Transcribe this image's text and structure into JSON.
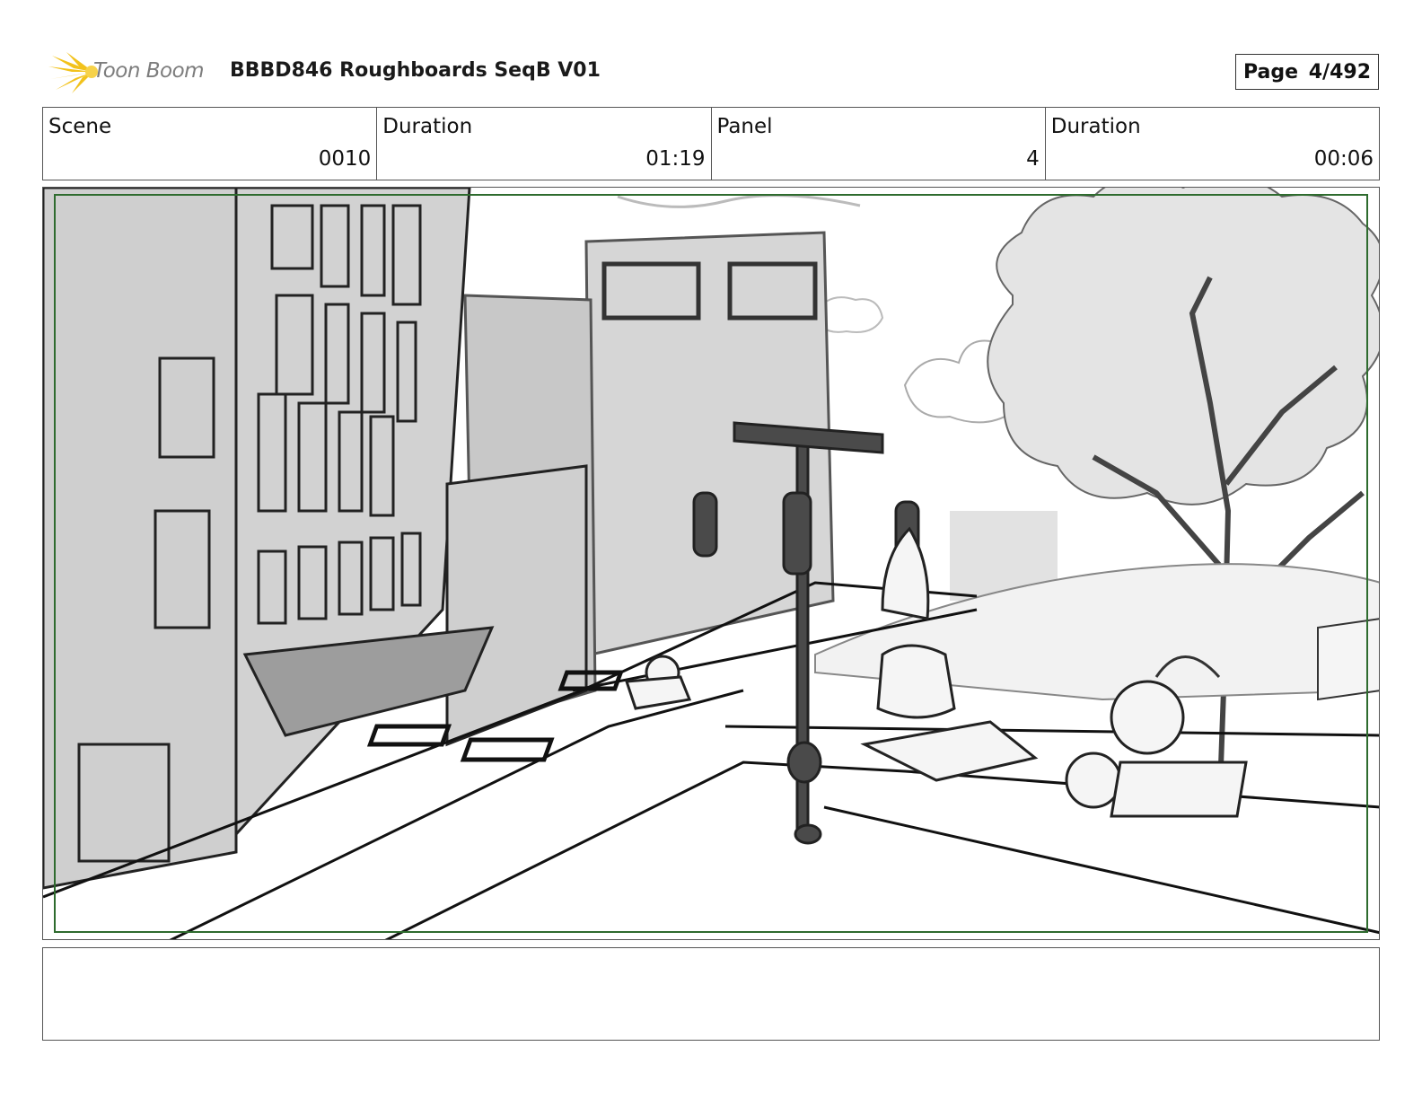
{
  "header": {
    "logo_text": "Toon Boom",
    "title": "BBBD846 Roughboards SeqB V01",
    "page_label": "Page",
    "page_value": "4/492"
  },
  "info": {
    "scene_label": "Scene",
    "scene_value": "0010",
    "scene_duration_label": "Duration",
    "scene_duration_value": "01:19",
    "panel_label": "Panel",
    "panel_value": "4",
    "panel_duration_label": "Duration",
    "panel_duration_value": "00:06"
  },
  "notes": {
    "text": ""
  },
  "colors": {
    "safe_frame": "#2e6b2e",
    "logo_star": "#f2c21b"
  }
}
